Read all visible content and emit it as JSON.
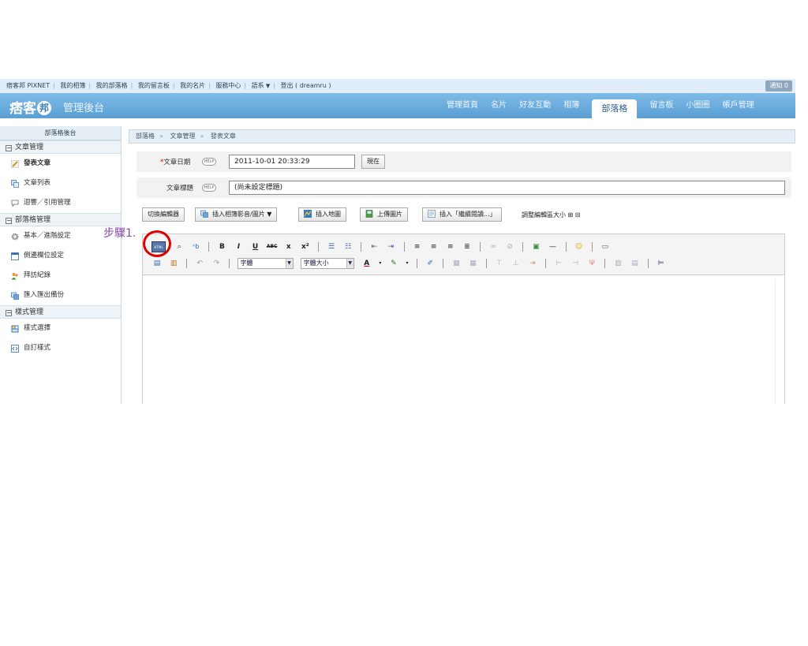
{
  "topbar": {
    "links": [
      "痞客邦 PIXNET",
      "我的相簿",
      "我的部落格",
      "我的留言板",
      "我的名片",
      "服務中心",
      "語系"
    ],
    "logout": "登出 ( dreamru )",
    "notify": "通知 0"
  },
  "header": {
    "brand": "痞客",
    "brand_mark": "邦",
    "subtitle": "管理後台",
    "nav": [
      "管理首頁",
      "名片",
      "好友互動",
      "相簿",
      "部落格",
      "留言板",
      "小圈圈",
      "帳戶管理"
    ],
    "active_nav": "部落格"
  },
  "sidebar": {
    "title": "部落格後台",
    "sections": [
      {
        "label": "文章管理",
        "items": [
          "發表文章",
          "文章列表",
          "迴響／引用管理"
        ]
      },
      {
        "label": "部落格管理",
        "items": [
          "基本／進階設定",
          "側邊欄位設定",
          "拜訪紀錄",
          "匯入匯出備份"
        ]
      },
      {
        "label": "樣式管理",
        "items": [
          "樣式選擇",
          "自訂樣式"
        ]
      }
    ]
  },
  "breadcrumb": [
    "部落格",
    "文章管理",
    "發表文章"
  ],
  "form": {
    "date_label": "文章日期",
    "date_required": "*",
    "help": "HELP",
    "date_value": "2011-10-01 20:33:29",
    "now_button": "現在",
    "title_label": "文章標題",
    "title_value": "(尚未設定標題)"
  },
  "actions": {
    "switch_editor": "切換編輯器",
    "insert_media": "插入相簿影音/圖片",
    "insert_map": "插入地圖",
    "upload_image": "上傳圖片",
    "insert_readmore": "插入「繼續閱讀...」",
    "resize_label": "調整編輯區大小",
    "resize_plus": "⊞",
    "resize_minus": "⊟"
  },
  "toolbar": {
    "html_icon": "HTML",
    "bold": "B",
    "italic": "I",
    "underline": "U",
    "strike": "ABC",
    "subscript": "x",
    "superscript": "x²",
    "font_select": "字體",
    "size_select": "字體大小",
    "font_color": "A"
  },
  "annotation": {
    "step": "步驟1."
  },
  "colors": {
    "header_blue": "#5a9fd4",
    "step_purple": "#8a4aa6",
    "circle_red": "#e00000"
  }
}
